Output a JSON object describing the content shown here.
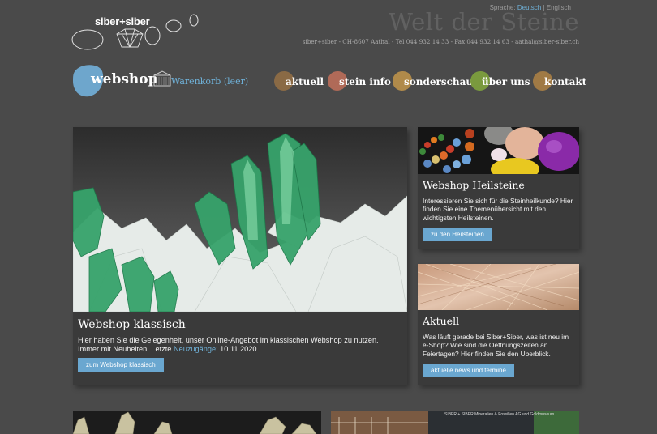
{
  "header": {
    "logo_text": "siber+siber",
    "lang_prefix": "Sprache:",
    "lang_de": "Deutsch",
    "lang_sep": "|",
    "lang_en": "Englisch",
    "title": "Welt der Steine",
    "contact": "siber+siber - CH-8607 Aathal - Tel 044 932 14 33 - Fax 044 932 14 63 - aathal@siber-siber.ch"
  },
  "webshop": {
    "label": "webshop",
    "cart_label": "Warenkorb (leer)"
  },
  "nav": [
    {
      "label": "aktuell",
      "color": "#8a6a45"
    },
    {
      "label": "stein info",
      "color": "#b06a58"
    },
    {
      "label": "sonderschau",
      "color": "#b08a4a"
    },
    {
      "label": "über uns",
      "color": "#7a9a3e"
    },
    {
      "label": "kontakt",
      "color": "#a07a45"
    }
  ],
  "cards": {
    "main": {
      "title": "Webshop klassisch",
      "text_before": "Hier haben Sie die Gelegenheit, unser Online-Angebot im klassischen Webshop zu nutzen. Immer mit Neuheiten. Letzte ",
      "text_link": "Neuzugänge",
      "text_after": ": 10.11.2020.",
      "button": "zum Webshop klassisch"
    },
    "heilsteine": {
      "title": "Webshop Heilsteine",
      "text": "Interessieren Sie sich für die Steinheilkunde? Hier finden Sie eine Themenübersicht mit den wichtigsten Heilsteinen.",
      "button": "zu den Heilsteinen"
    },
    "aktuell": {
      "title": "Aktuell",
      "text": "Was läuft gerade bei Siber+Siber, was ist neu im e-Shop? Wie sind die Oeffnungszeiten an Feiertagen? Hier finden Sie den Überblick.",
      "button": "aktuelle news und termine"
    }
  },
  "bottom": {
    "sign_text": "SIBER + SIBER  Mineralien & Fossilien AG und Goldmuseum"
  },
  "colors": {
    "accent": "#6fb1d8",
    "button": "#6aa7d0",
    "background": "#4a4a4a",
    "card": "#3a3a3a"
  }
}
